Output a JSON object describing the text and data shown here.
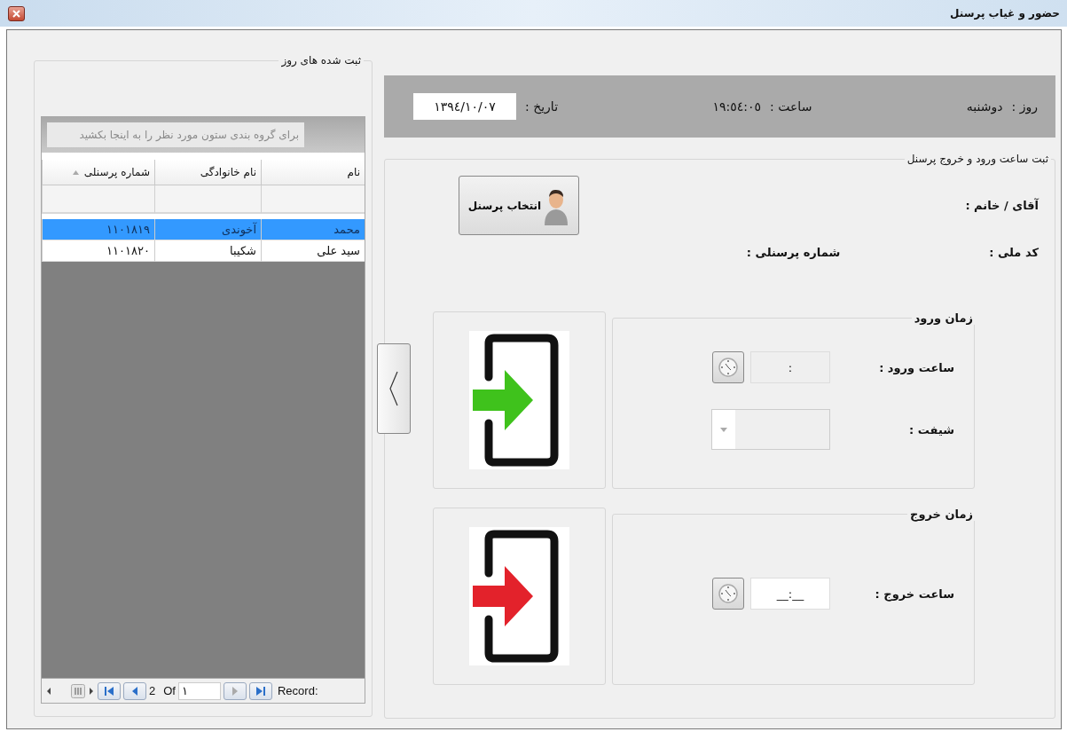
{
  "window": {
    "title": "حضور و غیاب پرسنل"
  },
  "daily_records": {
    "title": "ثبت شده های روز",
    "group_hint": "برای گروه بندی ستون مورد نظر را به اینجا بکشید",
    "columns": [
      {
        "label": "نام",
        "sorted": false
      },
      {
        "label": "نام خانوادگی",
        "sorted": false
      },
      {
        "label": "شماره پرسنلی",
        "sorted": true
      }
    ],
    "rows": [
      {
        "cells": [
          "محمد",
          "آخوندی",
          "١١٠١٨١٩"
        ],
        "selected": true
      },
      {
        "cells": [
          "سید علی",
          "شکیبا",
          "١١٠١٨٢٠"
        ],
        "selected": false
      }
    ],
    "navigator": {
      "total": "2",
      "of": "Of",
      "current": "١",
      "label": "Record:"
    }
  },
  "header": {
    "day_label": "روز :",
    "day": "دوشنبه",
    "time_label": "ساعت :",
    "time": "١٩:٥٤:٠٥",
    "date_label": "تاریخ :",
    "date": "١٣٩٤/١٠/٠٧"
  },
  "registration": {
    "title": "ثبت ساعت ورود و خروج پرسنل",
    "select_button": "انتخاب پرسنل",
    "person_label": "آقای / خانم :",
    "national_id_label": "کد ملی :",
    "personnel_number_label": "شماره پرسنلی :",
    "sections": [
      {
        "kind": "entry",
        "title": "زمان ورود",
        "fields": [
          {
            "kind": "time",
            "label": "ساعت ورود :",
            "value": ":",
            "disabled": true
          },
          {
            "kind": "dropdown",
            "label": "شیفت :",
            "disabled": true
          }
        ]
      },
      {
        "kind": "exit",
        "title": "زمان خروج",
        "fields": [
          {
            "kind": "time",
            "label": "ساعت خروج :",
            "value": "__:__",
            "disabled": false
          }
        ]
      }
    ]
  }
}
